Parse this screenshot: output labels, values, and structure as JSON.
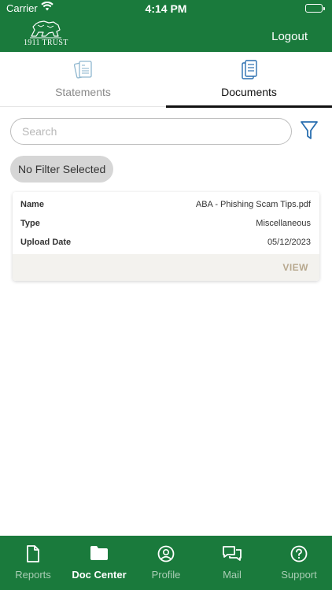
{
  "status_bar": {
    "carrier": "Carrier",
    "time": "4:14 PM"
  },
  "header": {
    "logo_text": "1911 TRUST",
    "logout_label": "Logout",
    "background_color": "#1a7a3c"
  },
  "tabs": [
    {
      "label": "Statements",
      "icon": "statements-icon",
      "active": false
    },
    {
      "label": "Documents",
      "icon": "documents-icon",
      "active": true
    }
  ],
  "search": {
    "placeholder": "Search",
    "value": ""
  },
  "filter": {
    "chip_label": "No Filter Selected",
    "icon": "filter-icon",
    "accent_color": "#2a6fb0"
  },
  "documents": [
    {
      "name_label": "Name",
      "name_value": "ABA - Phishing Scam Tips.pdf",
      "type_label": "Type",
      "type_value": "Miscellaneous",
      "date_label": "Upload Date",
      "date_value": "05/12/2023",
      "view_label": "VIEW"
    }
  ],
  "bottom_nav": [
    {
      "label": "Reports",
      "icon": "document-icon",
      "active": false
    },
    {
      "label": "Doc Center",
      "icon": "folder-icon",
      "active": true
    },
    {
      "label": "Profile",
      "icon": "profile-icon",
      "active": false
    },
    {
      "label": "Mail",
      "icon": "chat-icon",
      "active": false
    },
    {
      "label": "Support",
      "icon": "help-icon",
      "active": false
    }
  ]
}
